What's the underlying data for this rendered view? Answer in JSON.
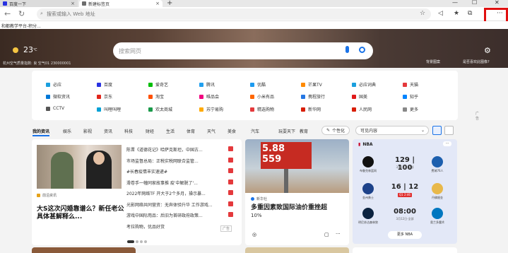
{
  "tabs": [
    {
      "label": "百度一下",
      "close": "×"
    },
    {
      "label": "新建标签页",
      "close": "×"
    }
  ],
  "new_tab": "+",
  "window_controls": [
    "—",
    "☐",
    "✕"
  ],
  "address": {
    "placeholder": "搜索或输入 Web 地址"
  },
  "favorites_text": "和都教学平台-积分...",
  "weather": {
    "temp": "23",
    "unit": "℃",
    "aqi": "杭州空气质量指数: 良 空气01 230000001"
  },
  "search": {
    "placeholder": "搜索网页"
  },
  "hero_links": {
    "wallpaper": "背景图案",
    "toggle": "是否喜欢此图像?"
  },
  "sites": [
    {
      "label": "必应",
      "color": "#1a9fde"
    },
    {
      "label": "百度",
      "color": "#2932e1"
    },
    {
      "label": "爱奇艺",
      "color": "#00be06"
    },
    {
      "label": "腾讯",
      "color": "#22a0ef"
    },
    {
      "label": "优酷",
      "color": "#1d9bf0"
    },
    {
      "label": "芒果TV",
      "color": "#ff8a00"
    },
    {
      "label": "必应词典",
      "color": "#1a9fde"
    },
    {
      "label": "天猫",
      "color": "#e4393c"
    },
    {
      "label": "微软资讯",
      "color": "#0078d7"
    },
    {
      "label": "京东",
      "color": "#e1251b"
    },
    {
      "label": "淘宝",
      "color": "#ff5000"
    },
    {
      "label": "唯品会",
      "color": "#f10180"
    },
    {
      "label": "小米有品",
      "color": "#ff6700"
    },
    {
      "label": "携程旅行",
      "color": "#2577e3"
    },
    {
      "label": "国美",
      "color": "#e01a1a"
    },
    {
      "label": "知乎",
      "color": "#0084ff"
    },
    {
      "label": "CCTV",
      "color": "#555555"
    },
    {
      "label": "叫哩叫哩",
      "color": "#00a1d6"
    },
    {
      "label": "欢太商城",
      "color": "#1a9a4a"
    },
    {
      "label": "苏宁易购",
      "color": "#ffaa00"
    },
    {
      "label": "精选购物",
      "color": "#e4393c"
    },
    {
      "label": "新华网",
      "color": "#d81e06"
    },
    {
      "label": "人民网",
      "color": "#d81e06"
    },
    {
      "label": "更多",
      "color": "#888888"
    }
  ],
  "ad_label": "广告",
  "categories": [
    "我的资讯",
    "娱乐",
    "影视",
    "资讯",
    "科技",
    "财经",
    "生活",
    "体育",
    "天气",
    "美食",
    "汽车",
    "玩耍天下",
    "教育"
  ],
  "personalize": "个性化",
  "visible_content": "可见内容",
  "news": {
    "source": "前沿资讯",
    "headline": "大S这次闪婚靠谱么？新任老公具体甚解释么...",
    "list": [
      {
        "text": "陈晋《道德花记》哈萨克斯坦，中国古...",
        "color": "#e4393c"
      },
      {
        "text": "市场监督总局：正税实税网联合监管...",
        "color": "#e4393c"
      },
      {
        "text": "#长春疫情丰实速递#",
        "color": "#e4393c"
      },
      {
        "text": "滑卷手一幢同家故事推 疫'中解脱了'...",
        "color": "#e4393c"
      },
      {
        "text": "2022年网络TF 开大于2个多月，操示暴...",
        "color": "#e4393c"
      },
      {
        "text": "光影网络共同营资：无奔体验升华 工作游戏...",
        "color": "#e4393c"
      },
      {
        "text": "游戏中国际用品：后旧为首研政府政策...",
        "color": "#e4393c"
      },
      {
        "text": "考拉购物，优品好货",
        "color": "#ffffff"
      }
    ],
    "tag": "广告"
  },
  "mid": {
    "sign_top": "5.88",
    "sign_bottom": "559",
    "source": "新华社",
    "title": "多重因素致国际油价重挫超",
    "subtitle": "10%"
  },
  "nba": {
    "header": "NBA",
    "games": [
      {
        "home": "布鲁克林篮网",
        "home_color": "#111111",
        "away": "费城76人",
        "away_color": "#1d5fae",
        "score": "129 | 100",
        "date": "3月11日·全部",
        "status": ""
      },
      {
        "home": "金州勇士",
        "home_color": "#1d428a",
        "away": "丹佛掘金",
        "away_color": "#e8b84a",
        "score": "16 | 12",
        "date": "",
        "status": "Q1 2:46"
      },
      {
        "home": "明尼苏达森林狼",
        "home_color": "#0c2340",
        "away": "奥兰多魔术",
        "away_color": "#0077c0",
        "score": "08:00",
        "date": "3月12日·全部",
        "status": ""
      }
    ],
    "more": "更多 NBA"
  }
}
